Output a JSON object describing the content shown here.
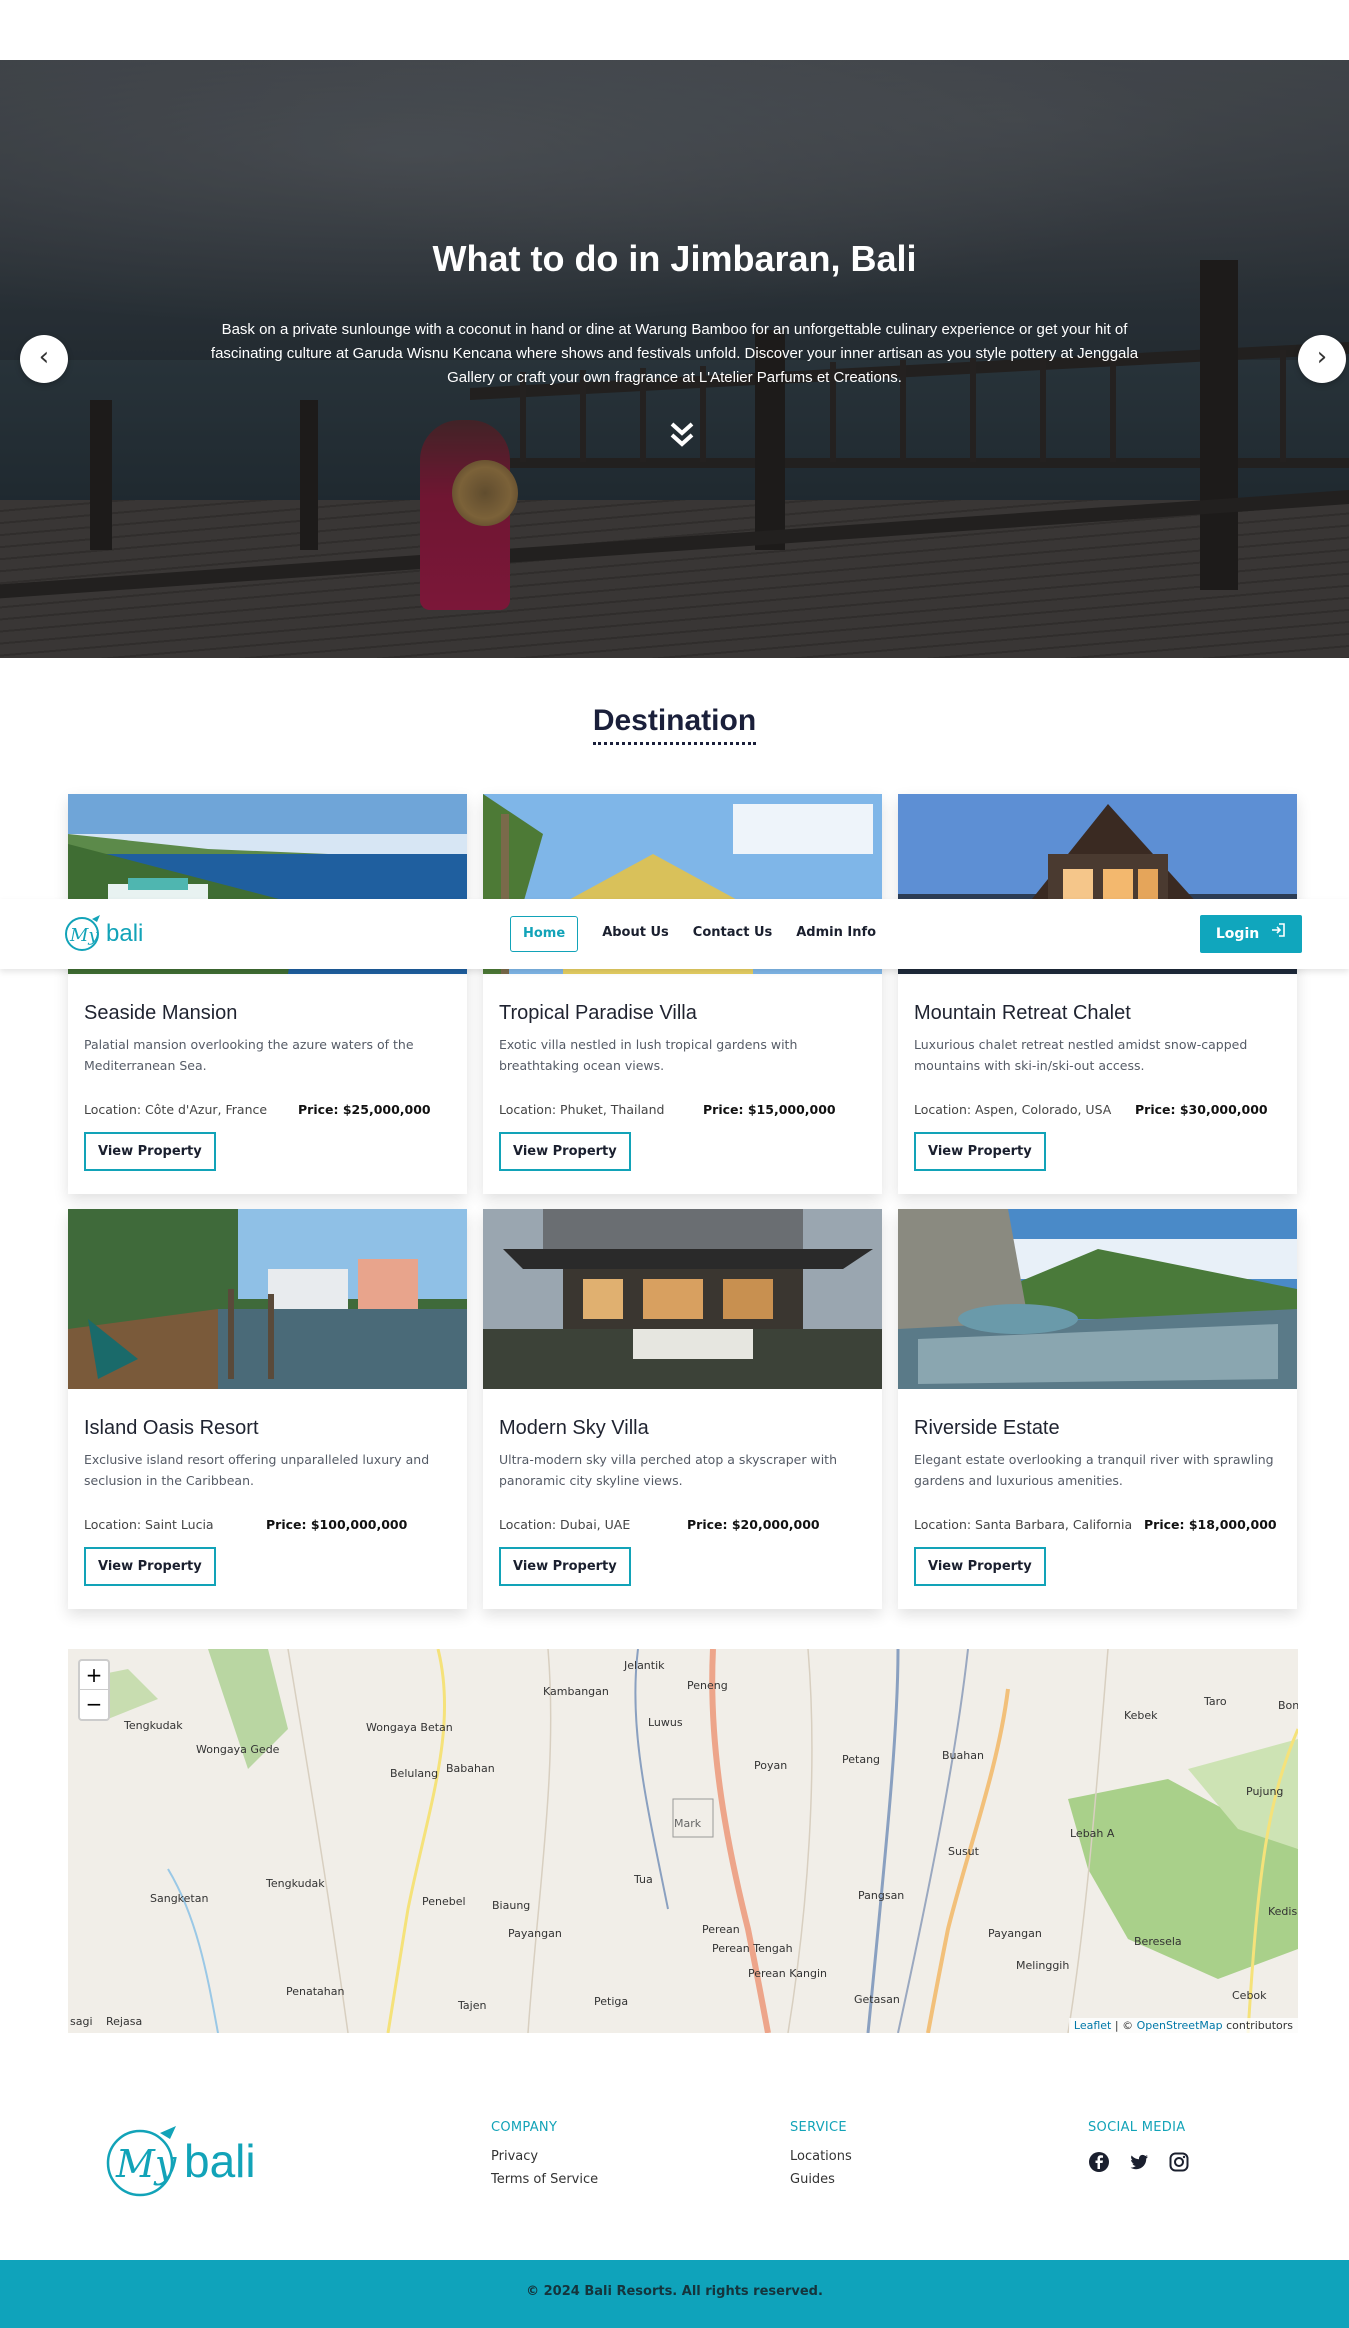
{
  "hero": {
    "title": "What to do in Jimbaran, Bali",
    "text": "Bask on a private sunlounge with a coconut in hand or dine at Warung Bamboo for an unforgettable culinary experience or get your hit of fascinating culture at Garuda Wisnu Kencana where shows and festivals unfold. Discover your inner artisan as you style pottery at Jenggala Gallery or craft your own fragrance at L'Atelier Parfums et Creations.",
    "prev_icon": "‹",
    "next_icon": "›",
    "scroll_icon": "double-chevron-down-icon"
  },
  "navbar": {
    "logo_text": "bali",
    "logo_script": "My",
    "links": [
      "Home",
      "About Us",
      "Contact Us",
      "Admin Info"
    ],
    "active": "Home",
    "login_label": "Login"
  },
  "destination": {
    "title": "Destination",
    "button_label": "View Property",
    "cards": [
      {
        "name": "Seaside Mansion",
        "description": "Palatial mansion overlooking the azure waters of the Mediterranean Sea.",
        "location": "Location: Côte d'Azur, France",
        "price": "Price: $25,000,000"
      },
      {
        "name": "Tropical Paradise Villa",
        "description": "Exotic villa nestled in lush tropical gardens with breathtaking ocean views.",
        "location": "Location: Phuket, Thailand",
        "price": "Price: $15,000,000"
      },
      {
        "name": "Mountain Retreat Chalet",
        "description": "Luxurious chalet retreat nestled amidst snow-capped mountains with ski-in/ski-out access.",
        "location": "Location: Aspen, Colorado, USA",
        "price": "Price: $30,000,000"
      },
      {
        "name": "Island Oasis Resort",
        "description": "Exclusive island resort offering unparalleled luxury and seclusion in the Caribbean.",
        "location": "Location: Saint Lucia",
        "price": "Price: $100,000,000"
      },
      {
        "name": "Modern Sky Villa",
        "description": "Ultra-modern sky villa perched atop a skyscraper with panoramic city skyline views.",
        "location": "Location: Dubai, UAE",
        "price": "Price: $20,000,000"
      },
      {
        "name": "Riverside Estate",
        "description": "Elegant estate overlooking a tranquil river with sprawling gardens and luxurious amenities.",
        "location": "Location: Santa Barbara, California",
        "price": "Price: $18,000,000"
      }
    ]
  },
  "map": {
    "zoom_in": "+",
    "zoom_out": "−",
    "marker_alt": "Mark",
    "attribution_leaflet": "Leaflet",
    "attribution_sep": " | © ",
    "attribution_osm": "OpenStreetMap",
    "attribution_tail": " contributors",
    "places": [
      "Jelantik",
      "Kambangan",
      "Peneng",
      "Luwus",
      "Tengkudak",
      "Wongaya Gede",
      "Wongaya Betan",
      "Belulang",
      "Babahan",
      "Poyan",
      "Petang",
      "Buahan",
      "Kebek",
      "Taro",
      "Bon",
      "Pujung",
      "Lebah A",
      "Susut",
      "Tua",
      "Sangketan",
      "Tengkudak",
      "Penebel",
      "Biaung",
      "Payangan",
      "Perean",
      "Perean Tengah",
      "Perean Kangin",
      "Pangsan",
      "Payangan",
      "Beresela",
      "Melinggih",
      "Kedis",
      "Penatahan",
      "Tajen",
      "Petiga",
      "Getasan",
      "Cebok",
      "sagi",
      "Rejasa"
    ]
  },
  "footer": {
    "company_head": "COMPANY",
    "company_items": [
      "Privacy",
      "Terms of Service"
    ],
    "service_head": "SERVICE",
    "service_items": [
      "Locations",
      "Guides"
    ],
    "social_head": "SOCIAL MEDIA",
    "social_icons": [
      "facebook-icon",
      "twitter-icon",
      "instagram-icon"
    ],
    "copyright": "© 2024 Bali Resorts. All rights reserved."
  },
  "colors": {
    "accent": "#10a6bd",
    "dark_text": "#1a1f3a"
  }
}
